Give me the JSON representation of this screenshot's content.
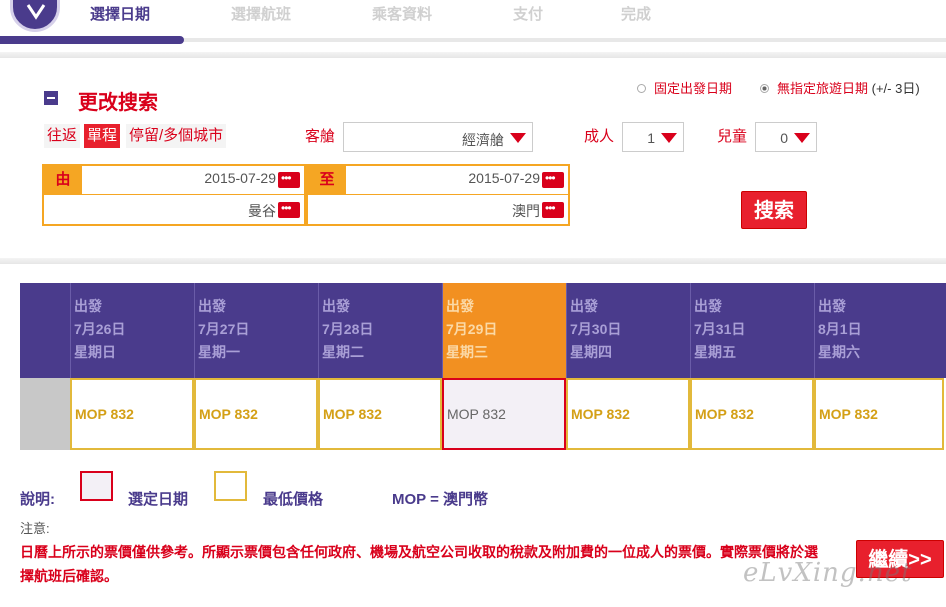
{
  "progress": {
    "steps": [
      "選擇日期",
      "選擇航班",
      "乘客資料",
      "支付",
      "完成"
    ],
    "active_index": 0
  },
  "search": {
    "title": "更改搜索",
    "date_mode": {
      "fixed_label": "固定出發日期",
      "flexible_label": "無指定旅遊日期",
      "flexible_note": "(+/- 3日)",
      "selected": "flexible"
    },
    "trip_types": [
      "往返",
      "單程",
      "停留/多個城市"
    ],
    "trip_type_selected": "單程",
    "cabin": {
      "label": "客艙",
      "value": "經濟艙"
    },
    "adults": {
      "label": "成人",
      "value": "1"
    },
    "children": {
      "label": "兒童",
      "value": "0"
    },
    "from": {
      "tag": "由",
      "date": "2015-07-29",
      "city": "曼谷"
    },
    "to": {
      "tag": "至",
      "date": "2015-07-29",
      "city": "澳門"
    },
    "search_button": "搜索"
  },
  "calendar": {
    "depart_label": "出發",
    "days": [
      {
        "date": "7月26日",
        "weekday": "星期日",
        "fare": "MOP 832"
      },
      {
        "date": "7月27日",
        "weekday": "星期一",
        "fare": "MOP 832"
      },
      {
        "date": "7月28日",
        "weekday": "星期二",
        "fare": "MOP 832"
      },
      {
        "date": "7月29日",
        "weekday": "星期三",
        "fare": "MOP 832"
      },
      {
        "date": "7月30日",
        "weekday": "星期四",
        "fare": "MOP 832"
      },
      {
        "date": "7月31日",
        "weekday": "星期五",
        "fare": "MOP 832"
      },
      {
        "date": "8月1日",
        "weekday": "星期六",
        "fare": "MOP 832"
      }
    ],
    "selected_index": 3
  },
  "legend": {
    "label": "說明:",
    "selected_date": "選定日期",
    "lowest_price": "最低價格",
    "currency_note": "MOP = 澳門幣"
  },
  "notice": {
    "label": "注意:",
    "text": "日曆上所示的票價僅供參考。所顯示票價包含任何政府、機場及航空公司收取的稅款及附加費的一位成人的票價。實際票價將於選擇航班后確認。"
  },
  "continue_button": "繼續>>",
  "watermark": "eLvXing.net",
  "colors": {
    "brand_purple": "#4a3b8c",
    "accent_red": "#d9001b",
    "highlight_orange": "#f29021",
    "gold": "#e2b93b"
  }
}
